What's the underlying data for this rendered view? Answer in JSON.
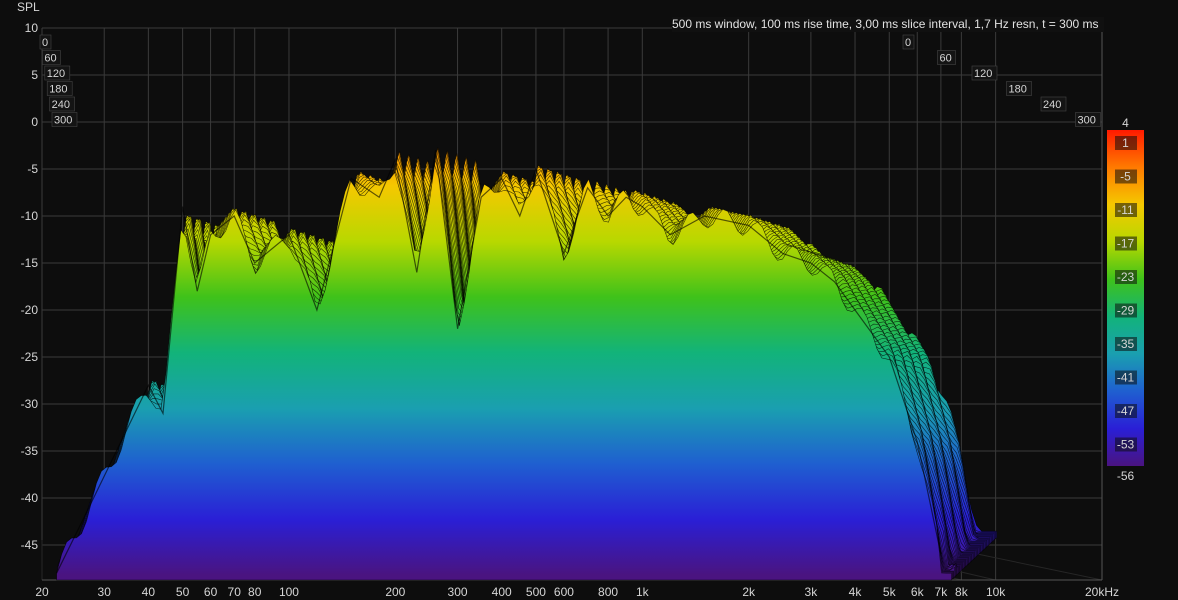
{
  "header": {
    "y_title": "SPL",
    "info": "500 ms window, 100 ms rise time, 3,00 ms slice interval, 1,7 Hz resn, t = 300 ms"
  },
  "colors": {
    "background": "#0d0d0d",
    "grid": "#3a3a3a",
    "text": "#d6d6d6",
    "scale_stops": [
      "#ff1a00",
      "#ff7a00",
      "#f5c800",
      "#b8d800",
      "#3fc21a",
      "#12b37a",
      "#1a9fb0",
      "#1f5fd0",
      "#2a1fd6",
      "#4a1480"
    ]
  },
  "chart_data": {
    "type": "area",
    "title": "",
    "ylabel": "SPL",
    "xlabel": "",
    "x_unit_last": "20kHz",
    "ylim": [
      -48,
      10
    ],
    "x_scale": "log",
    "xlim": [
      20,
      20000
    ],
    "y_ticks": [
      "10",
      "5",
      "0",
      "-5",
      "-10",
      "-15",
      "-20",
      "-25",
      "-30",
      "-35",
      "-40",
      "-45"
    ],
    "x_ticks": [
      "20",
      "30",
      "40",
      "50",
      "60",
      "70",
      "80",
      "100",
      "200",
      "300",
      "400",
      "500",
      "600",
      "800",
      "1k",
      "2k",
      "3k",
      "4k",
      "5k",
      "6k",
      "7k",
      "8k",
      "10k",
      "20kHz"
    ],
    "time_unit": "ms",
    "time_ticks_left": [
      "0",
      "60",
      "120",
      "180",
      "240",
      "300"
    ],
    "time_ticks_right": [
      "0",
      "60",
      "120",
      "180",
      "240",
      "300"
    ],
    "color_scale": {
      "max_label": "4",
      "min_label": "-56",
      "labels": [
        "1",
        "-5",
        "-11",
        "-17",
        "-23",
        "-29",
        "-35",
        "-41",
        "-47",
        "-53"
      ]
    },
    "series": [
      {
        "slice": "front",
        "x": [
          22,
          28,
          40,
          44,
          50,
          55,
          60,
          70,
          80,
          100,
          120,
          150,
          180,
          200,
          230,
          260,
          300,
          350,
          400,
          450,
          500,
          600,
          700,
          800,
          900,
          1000,
          1200,
          1500,
          2000,
          2500,
          3000,
          3500,
          4000,
          5000,
          6000,
          7000
        ],
        "values": [
          -48,
          -40,
          -28,
          -31,
          -9,
          -18,
          -12,
          -10,
          -15,
          -12,
          -20,
          -6,
          -8,
          -4,
          -16,
          -3,
          -22,
          -8,
          -6,
          -10,
          -5,
          -14,
          -7,
          -10,
          -8,
          -9,
          -12,
          -10,
          -11,
          -14,
          -15,
          -17,
          -20,
          -25,
          -34,
          -46
        ]
      }
    ]
  }
}
